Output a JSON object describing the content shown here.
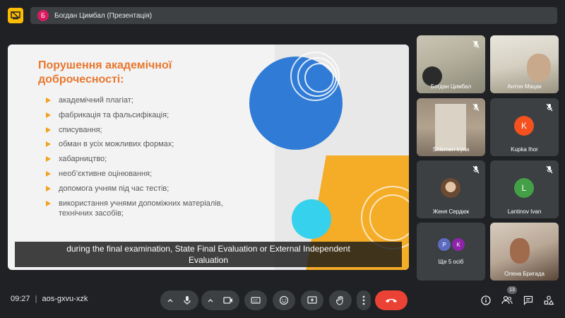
{
  "top": {
    "presenter_initial": "Б",
    "presenter_label": "Богдан Цимбал (Презентація)"
  },
  "slide": {
    "title_line1": "Порушення академічної",
    "title_line2": "доброчесності:",
    "bullets": [
      "академічний плагіат;",
      "фабрикація та фальсифікація;",
      "списування;",
      "обман в усіх можливих формах;",
      "хабарництво;",
      "необ’єктивне оцінювання;",
      "допомога учням під час тестів;",
      "використання учнями допоміжних матеріалів,",
      "технічних засобів;"
    ],
    "colors": {
      "title": "#e8772e",
      "bullet": "#f2a21b",
      "blue": "#2f7bd6",
      "yellow": "#f5ac27",
      "cyan": "#36d1ec"
    }
  },
  "caption": {
    "line1": "during the final examination, State Final Evaluation or External Independent",
    "line2": "Evaluation"
  },
  "participants": [
    {
      "name": "Богдан Цимбал",
      "muted": true
    },
    {
      "name": "Антон Мацак",
      "muted": false
    },
    {
      "name": "Shlemen Iryna",
      "muted": true
    },
    {
      "name": "Kupka Ihor",
      "initial": "K",
      "color": "#f4511e",
      "muted": true
    },
    {
      "name": "Женя Сердюк",
      "muted": true
    },
    {
      "name": "Lantinov Ivan",
      "initial": "L",
      "color": "#43a047",
      "muted": true
    },
    {
      "name": "Ще 5 осіб",
      "initials": [
        "P",
        "K"
      ],
      "muted": false
    },
    {
      "name": "Олена Бригада",
      "muted": false
    }
  ],
  "bottom": {
    "time": "09:27",
    "separator": "|",
    "meeting_code": "aos-gxvu-xzk",
    "participant_count": "13"
  }
}
